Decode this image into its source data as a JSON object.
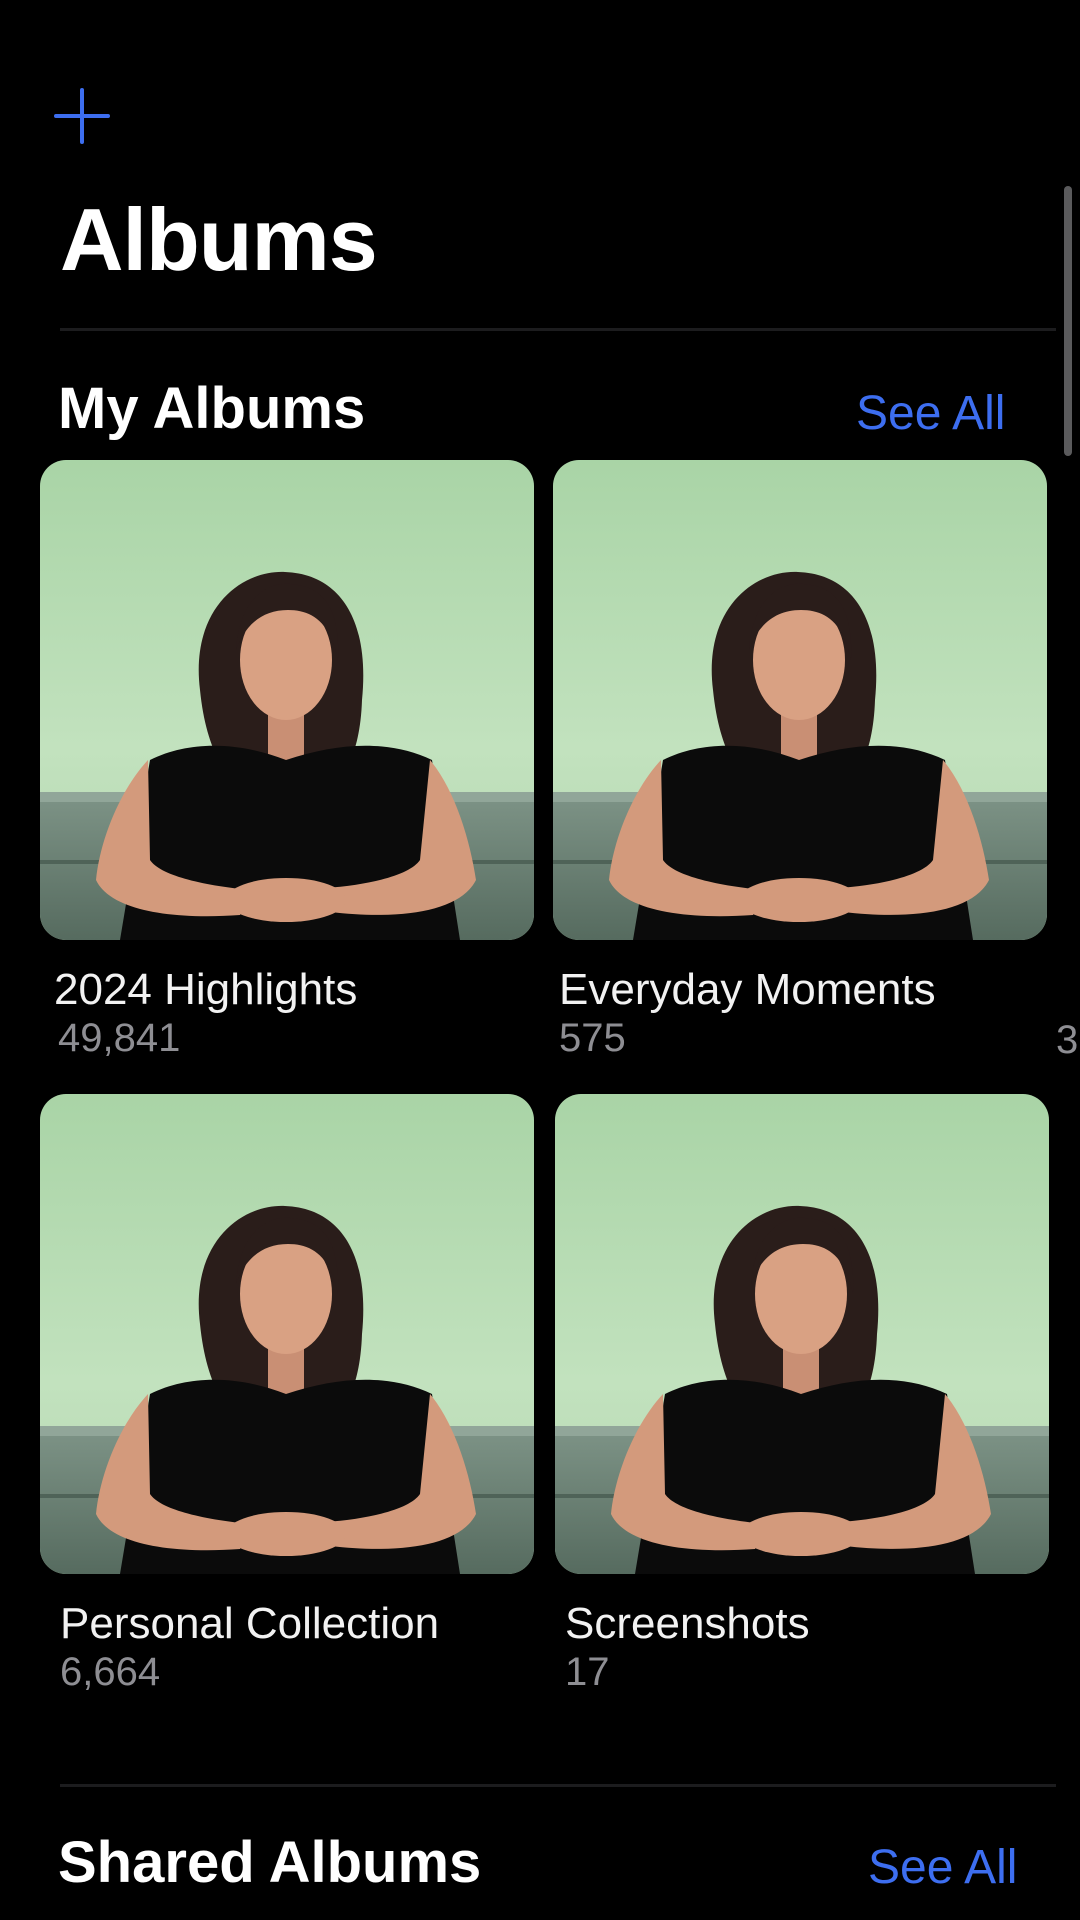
{
  "header": {
    "add_icon": "plus-icon",
    "title": "Albums"
  },
  "my_albums": {
    "title": "My Albums",
    "see_all_label": "See All",
    "albums": [
      {
        "name": "2024 Highlights",
        "count": "49,841"
      },
      {
        "name": "Everyday Moments",
        "count": "575"
      },
      {
        "name": "Personal Collection",
        "count": "6,664"
      },
      {
        "name": "Screenshots",
        "count": "17"
      }
    ],
    "peek_count": "3"
  },
  "shared_albums": {
    "title": "Shared Albums",
    "see_all_label": "See All"
  },
  "colors": {
    "accent": "#3d6ef0",
    "background": "#000000",
    "thumb_wall": "#b6dcb4",
    "thumb_sofa": "#6f8578"
  }
}
